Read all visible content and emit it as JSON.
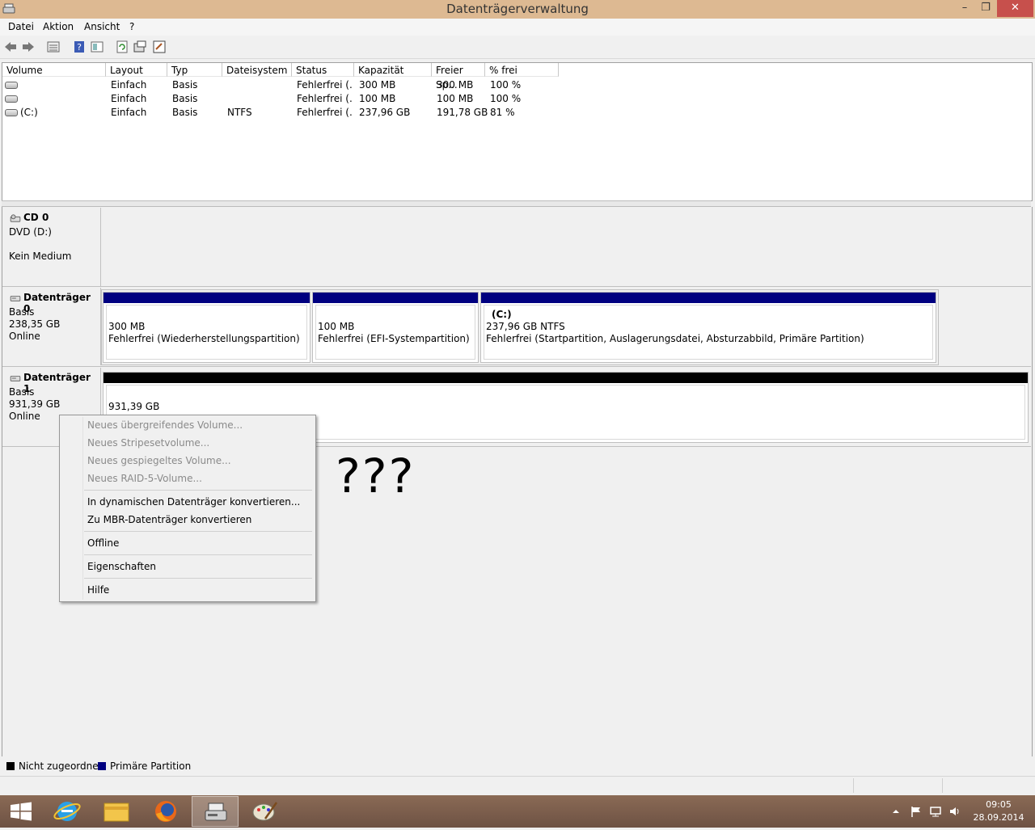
{
  "window": {
    "title": "Datenträgerverwaltung",
    "minimize_glyph": "–",
    "restore_glyph": "❐",
    "close_glyph": "✕"
  },
  "menu": [
    "Datei",
    "Aktion",
    "Ansicht",
    "?"
  ],
  "toolbar": [
    "back-arrow-icon",
    "forward-arrow-icon",
    "list-view-icon",
    "help-icon",
    "properties-icon",
    "refresh-icon",
    "settings-icon",
    "wizard-icon"
  ],
  "volume_table": {
    "headers": [
      "Volume",
      "Layout",
      "Typ",
      "Dateisystem",
      "Status",
      "Kapazität",
      "Freier Sp...",
      "% frei"
    ],
    "rows": [
      [
        "",
        "Einfach",
        "Basis",
        "",
        "Fehlerfrei (...",
        "300 MB",
        "300 MB",
        "100 %"
      ],
      [
        "",
        "Einfach",
        "Basis",
        "",
        "Fehlerfrei (...",
        "100 MB",
        "100 MB",
        "100 %"
      ],
      [
        "(C:)",
        "Einfach",
        "Basis",
        "NTFS",
        "Fehlerfrei (...",
        "237,96 GB",
        "191,78 GB",
        "81 %"
      ]
    ]
  },
  "disks": {
    "cd0": {
      "name": "CD 0",
      "line1": "DVD (D:)",
      "line2": "Kein Medium"
    },
    "disk0": {
      "name": "Datenträger 0",
      "type": "Basis",
      "size": "238,35 GB",
      "state": "Online",
      "partitions": [
        {
          "label": "",
          "size": "300 MB",
          "status": "Fehlerfrei (Wiederherstellungspartition)"
        },
        {
          "label": "",
          "size": "100 MB",
          "status": "Fehlerfrei (EFI-Systempartition)"
        },
        {
          "label": "(C:)",
          "size": "237,96 GB NTFS",
          "status": "Fehlerfrei (Startpartition, Auslagerungsdatei, Absturzabbild, Primäre Partition)"
        }
      ]
    },
    "disk1": {
      "name": "Datenträger 1",
      "type": "Basis",
      "size": "931,39 GB",
      "state": "Online",
      "unallocated": {
        "size": "931,39 GB"
      }
    }
  },
  "context_menu": {
    "items": [
      {
        "label": "Neues übergreifendes Volume...",
        "enabled": false
      },
      {
        "label": "Neues Stripesetvolume...",
        "enabled": false
      },
      {
        "label": "Neues gespiegeltes Volume...",
        "enabled": false
      },
      {
        "label": "Neues RAID-5-Volume...",
        "enabled": false
      },
      {
        "label": "In dynamischen Datenträger konvertieren...",
        "enabled": true
      },
      {
        "label": "Zu MBR-Datenträger konvertieren",
        "enabled": true
      },
      {
        "label": "Offline",
        "enabled": true
      },
      {
        "label": "Eigenschaften",
        "enabled": true
      },
      {
        "label": "Hilfe",
        "enabled": true
      }
    ]
  },
  "annotation": "???",
  "legend": [
    {
      "label": "Nicht zugeordnet",
      "color": "#000000"
    },
    {
      "label": "Primäre Partition",
      "color": "#000080"
    }
  ],
  "colors": {
    "primary_partition": "#000080",
    "unallocated": "#000000",
    "titlebar": "#ddb992"
  },
  "taskbar": {
    "apps": [
      "start-icon",
      "internet-explorer-icon",
      "file-explorer-icon",
      "firefox-icon",
      "disk-management-icon",
      "paint-icon"
    ],
    "clock_time": "09:05",
    "clock_date": "28.09.2014"
  }
}
